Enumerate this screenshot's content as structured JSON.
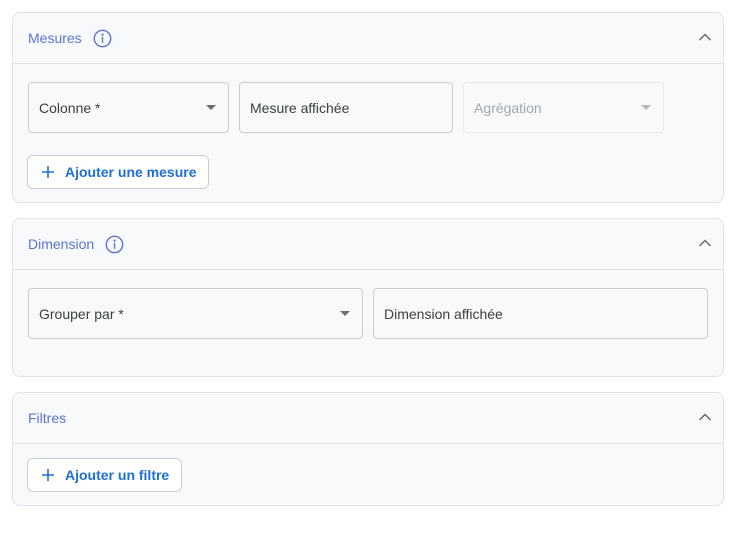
{
  "measures": {
    "title": "Mesures",
    "column_placeholder": "Colonne *",
    "display_placeholder": "Mesure affichée",
    "aggregation_placeholder": "Agrégation",
    "add_label": "Ajouter une mesure"
  },
  "dimension": {
    "title": "Dimension",
    "group_by_placeholder": "Grouper par *",
    "display_placeholder": "Dimension affichée"
  },
  "filters": {
    "title": "Filtres",
    "add_label": "Ajouter un filtre"
  },
  "colors": {
    "title": "#5b74d6",
    "button_text": "#1f6fd6",
    "panel_bg": "#f7f9fa",
    "border": "#dfe3e8"
  }
}
